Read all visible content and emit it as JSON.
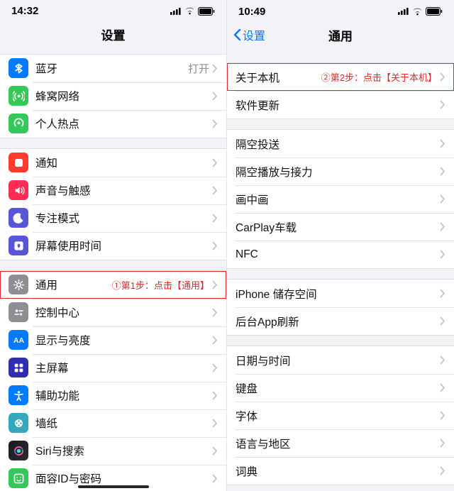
{
  "left": {
    "status": {
      "time": "14:32"
    },
    "nav": {
      "title": "设置"
    },
    "groups": [
      [
        {
          "k": "bluetooth",
          "label": "蓝牙",
          "value": "打开"
        },
        {
          "k": "cellular",
          "label": "蜂窝网络"
        },
        {
          "k": "hotspot",
          "label": "个人热点"
        }
      ],
      [
        {
          "k": "notifications",
          "label": "通知"
        },
        {
          "k": "sound",
          "label": "声音与触感"
        },
        {
          "k": "focus",
          "label": "专注模式"
        },
        {
          "k": "screentime",
          "label": "屏幕使用时间"
        }
      ],
      [
        {
          "k": "general",
          "label": "通用",
          "annot": "①第1步：点击【通用】",
          "hl": true
        },
        {
          "k": "controlcenter",
          "label": "控制中心"
        },
        {
          "k": "display",
          "label": "显示与亮度"
        },
        {
          "k": "homescreen",
          "label": "主屏幕"
        },
        {
          "k": "accessibility",
          "label": "辅助功能"
        },
        {
          "k": "wallpaper",
          "label": "墙纸"
        },
        {
          "k": "siri",
          "label": "Siri与搜索"
        },
        {
          "k": "faceid",
          "label": "面容ID与密码"
        }
      ]
    ]
  },
  "right": {
    "status": {
      "time": "10:49"
    },
    "nav": {
      "title": "通用",
      "back": "设置"
    },
    "groups": [
      [
        {
          "k": "about",
          "label": "关于本机",
          "annot": "②第2步：点击【关于本机】",
          "hl": true
        },
        {
          "k": "update",
          "label": "软件更新"
        }
      ],
      [
        {
          "k": "airdrop",
          "label": "隔空投送"
        },
        {
          "k": "airplay",
          "label": "隔空播放与接力"
        },
        {
          "k": "pip",
          "label": "画中画"
        },
        {
          "k": "carplay",
          "label": "CarPlay车载"
        },
        {
          "k": "nfc",
          "label": "NFC"
        }
      ],
      [
        {
          "k": "storage",
          "label": "iPhone 储存空间"
        },
        {
          "k": "bgapp",
          "label": "后台App刷新"
        }
      ],
      [
        {
          "k": "datetime",
          "label": "日期与时间"
        },
        {
          "k": "keyboard",
          "label": "键盘"
        },
        {
          "k": "fonts",
          "label": "字体"
        },
        {
          "k": "lang",
          "label": "语言与地区"
        },
        {
          "k": "dict",
          "label": "词典"
        }
      ]
    ]
  },
  "iconMap": {
    "bluetooth": "ic-bt",
    "cellular": "ic-cell",
    "hotspot": "ic-hot",
    "notifications": "ic-noti",
    "sound": "ic-sound",
    "focus": "ic-focus",
    "screentime": "ic-scr",
    "general": "ic-gen",
    "controlcenter": "ic-cc",
    "display": "ic-disp",
    "homescreen": "ic-home",
    "accessibility": "ic-acc",
    "wallpaper": "ic-wall",
    "siri": "ic-siri",
    "faceid": "ic-face"
  }
}
